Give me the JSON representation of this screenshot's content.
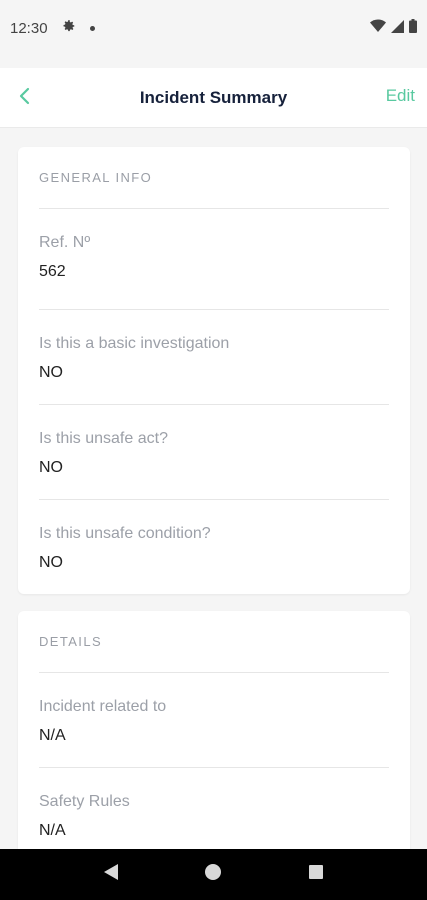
{
  "status_bar": {
    "time": "12:30",
    "icons": [
      "settings-gear-icon",
      "notification-dot-icon",
      "wifi-icon",
      "cell-signal-icon",
      "battery-icon"
    ]
  },
  "app_bar": {
    "title": "Incident Summary",
    "edit_label": "Edit",
    "back_icon": "chevron-left-icon"
  },
  "colors": {
    "accent": "#59c9a0",
    "title": "#16213b",
    "label": "#9ca0a8",
    "background": "#f5f5f5"
  },
  "general_info": {
    "header": "GENERAL INFO",
    "fields": [
      {
        "label": "Ref. Nº",
        "value": "562"
      },
      {
        "label": "Is this a basic investigation",
        "value": "NO"
      },
      {
        "label": "Is this unsafe act?",
        "value": "NO"
      },
      {
        "label": "Is this unsafe condition?",
        "value": "NO"
      }
    ]
  },
  "details": {
    "header": "DETAILS",
    "fields": [
      {
        "label": "Incident related to",
        "value": "N/A"
      },
      {
        "label": "Safety Rules",
        "value": "N/A"
      }
    ]
  },
  "nav_bar": {
    "icons": [
      "back-triangle-icon",
      "home-circle-icon",
      "recents-square-icon"
    ]
  }
}
